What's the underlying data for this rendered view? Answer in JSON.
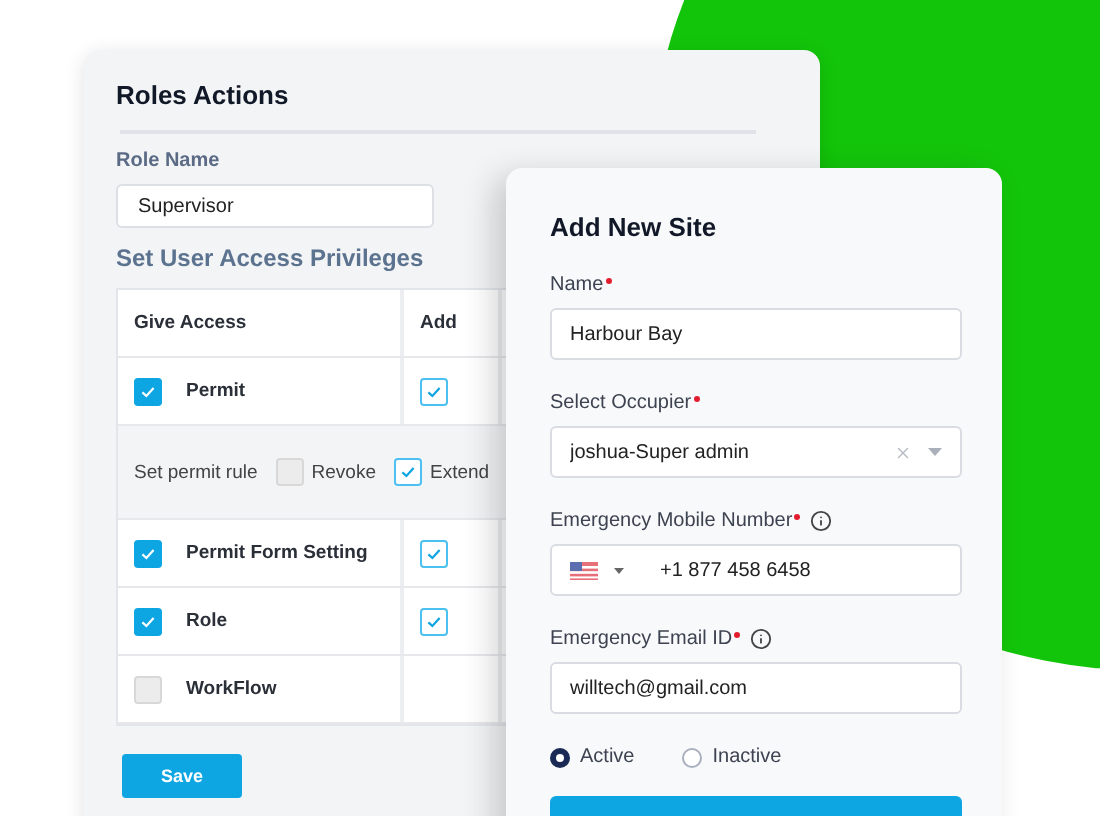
{
  "roles_card": {
    "title": "Roles Actions",
    "role_name_label": "Role Name",
    "role_name_value": "Supervisor",
    "section_title": "Set User Access Privileges",
    "table": {
      "columns": [
        "Give Access",
        "Add"
      ],
      "rows": [
        {
          "kind": "permission",
          "label": "Permit",
          "checked": true,
          "add_checked": true
        },
        {
          "kind": "rule",
          "label": "Set permit rule",
          "options": [
            {
              "label": "Revoke",
              "checked": false
            },
            {
              "label": "Extend",
              "checked": true
            }
          ]
        },
        {
          "kind": "permission",
          "label": "Permit Form Setting",
          "checked": true,
          "add_checked": true
        },
        {
          "kind": "permission",
          "label": "Role",
          "checked": true,
          "add_checked": true
        },
        {
          "kind": "permission",
          "label": "WorkFlow",
          "checked": false
        }
      ]
    },
    "save_button": "Save"
  },
  "site_form": {
    "title": "Add New Site",
    "fields": [
      {
        "kind": "text",
        "label": "Name",
        "required": true,
        "info": false,
        "value": "Harbour Bay"
      },
      {
        "kind": "select",
        "label": "Select Occupier",
        "required": true,
        "info": false,
        "value": "joshua-Super admin"
      },
      {
        "kind": "phone",
        "label": "Emergency Mobile Number",
        "required": true,
        "info": true,
        "value": "+1 877 458 6458"
      },
      {
        "kind": "text",
        "label": "Emergency Email ID",
        "required": true,
        "info": true,
        "value": "willtech@gmail.com"
      }
    ],
    "status_options": [
      {
        "label": "Active",
        "selected": true
      },
      {
        "label": "Inactive",
        "selected": false
      }
    ]
  }
}
